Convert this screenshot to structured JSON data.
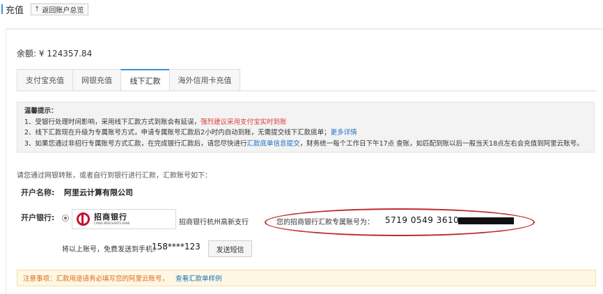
{
  "header": {
    "title": "充值",
    "back_button": "返回账户总览",
    "back_icon": "arrow-up-icon"
  },
  "balance": {
    "text": "余额: ¥ 124357.84"
  },
  "tabs": [
    {
      "label": "支付宝充值",
      "active": false
    },
    {
      "label": "网银充值",
      "active": false
    },
    {
      "label": "线下汇款",
      "active": true
    },
    {
      "label": "海外信用卡充值",
      "active": false
    }
  ],
  "tips": {
    "heading": "温馨提示：",
    "line1_text": "1、受银行处理时间影响，采用线下汇款方式到账会有延误，",
    "line1_highlight": "强烈建议采用支付宝实时到账",
    "line2_text": "2、线下汇款现在升级为专属账号方式，申请专属账号汇款后2小时内自动到账，无需提交线下汇款底单；",
    "line2_link": "更多详情",
    "line3_text_a": "3、如果您通过非招行专属账号方式汇款，在完成银行汇款后，请您尽快进行",
    "line3_link": "汇款底单信息提交",
    "line3_text_b": "，财务统一每个工作日下午17点 查账，如匹配到账以后一般当天18点左右会充值到阿里云账号。"
  },
  "intro": "请您通过网银转账，或者自行到银行进行汇款，汇款账号如下：",
  "account": {
    "name_label": "开户名称:",
    "name_value": "阿里云计算有限公司",
    "bank_label": "开户银行:",
    "bank_logo_cn": "招商银行",
    "bank_logo_en": "CHINA MERCHANTS BANK",
    "branch": "招商银行杭州高新支行",
    "number_label": "您的招商银行汇款专属账号为：",
    "number_value": "5719 0549 3610"
  },
  "sms": {
    "text": "将以上账号，免费发送到手机：",
    "phone": "158****123",
    "button": "发送短信"
  },
  "notice": {
    "text": "注意事项：汇款用途请务必填写您的阿里云账号，",
    "link": "查看汇款单样例"
  },
  "colors": {
    "accent": "#3d8fd6",
    "warning_red": "#e03c3c",
    "link_blue": "#1f6fbf",
    "circle_red": "#c0282e",
    "notice_orange": "#e06a1a"
  }
}
